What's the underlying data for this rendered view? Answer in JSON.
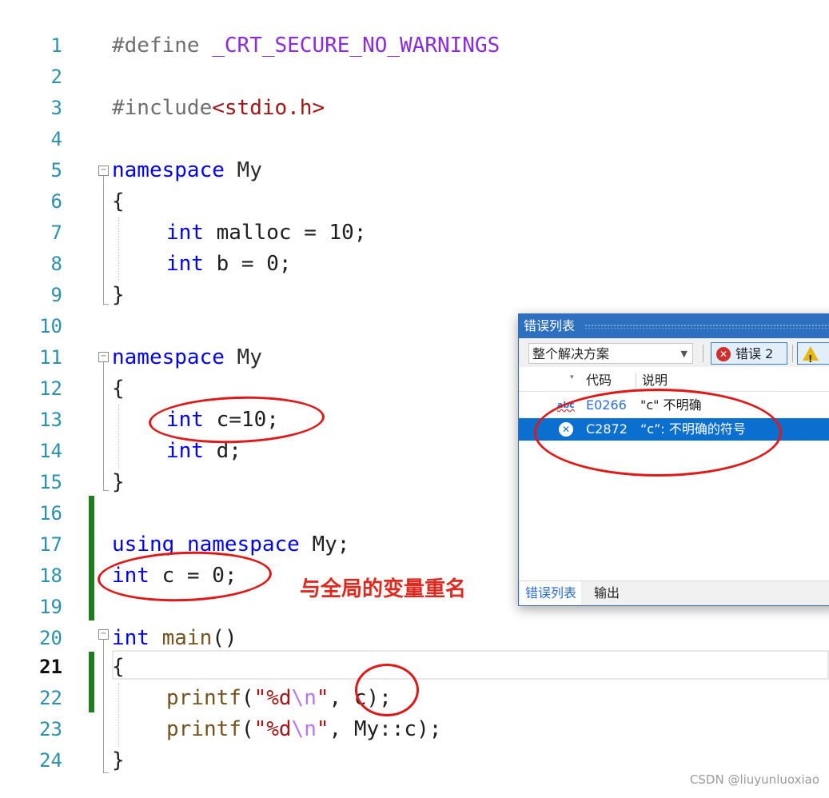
{
  "editor": {
    "lines": [
      {
        "num": "1"
      },
      {
        "num": "2"
      },
      {
        "num": "3"
      },
      {
        "num": "4"
      },
      {
        "num": "5"
      },
      {
        "num": "6"
      },
      {
        "num": "7"
      },
      {
        "num": "8"
      },
      {
        "num": "9"
      },
      {
        "num": "10"
      },
      {
        "num": "11"
      },
      {
        "num": "12"
      },
      {
        "num": "13"
      },
      {
        "num": "14"
      },
      {
        "num": "15"
      },
      {
        "num": "16"
      },
      {
        "num": "17"
      },
      {
        "num": "18"
      },
      {
        "num": "19"
      },
      {
        "num": "20"
      },
      {
        "num": "21"
      },
      {
        "num": "22"
      },
      {
        "num": "23"
      },
      {
        "num": "24"
      }
    ],
    "code": {
      "l1_directive": "#define",
      "l1_macro": "_CRT_SECURE_NO_WARNINGS",
      "l3_directive": "#include",
      "l3_header": "<stdio.h>",
      "l5_kw": "namespace",
      "l5_name": " My",
      "l6": "{",
      "l7_kw": "int",
      "l7_rest": " malloc = 10;",
      "l8_kw": "int",
      "l8_rest": " b = 0;",
      "l9": "}",
      "l11_kw": "namespace",
      "l11_name": " My",
      "l12": "{",
      "l13_kw": "int",
      "l13_rest": " c=10;",
      "l14_kw": "int",
      "l14_rest": " d;",
      "l15": "}",
      "l17_kw1": "using",
      "l17_kw2": "namespace",
      "l17_rest": " My;",
      "l18_kw": "int",
      "l18_rest": " c = 0;",
      "l20_kw": "int",
      "l20_fn": "main",
      "l20_rest": "()",
      "l21": "{",
      "l22_fn": "printf",
      "l22_open": "(",
      "l22_str1": "\"%d",
      "l22_esc": "\\n",
      "l22_str2": "\"",
      "l22_rest": ", c);",
      "l23_fn": "printf",
      "l23_open": "(",
      "l23_str1": "\"%d",
      "l23_esc": "\\n",
      "l23_str2": "\"",
      "l23_rest": ", My::c);",
      "l24": "}"
    },
    "annotation": "与全局的变量重名"
  },
  "error_list": {
    "title": "错误列表",
    "scope": "整个解决方案",
    "errors_button": "错误 2",
    "col_code": "代码",
    "col_desc": "说明",
    "rows": [
      {
        "code": "E0266",
        "desc": "\"c\" 不明确",
        "icon": "abc"
      },
      {
        "code": "C2872",
        "desc": "“c”: 不明确的符号"
      }
    ],
    "tab_errors": "错误列表",
    "tab_output": "输出"
  },
  "watermark": "CSDN @liuyunluoxiao",
  "colors": {
    "keyword": "#0000ff",
    "macro": "#8a2be2",
    "string": "#a31515",
    "linenum": "#2b91af",
    "annotation": "#e0281e"
  }
}
